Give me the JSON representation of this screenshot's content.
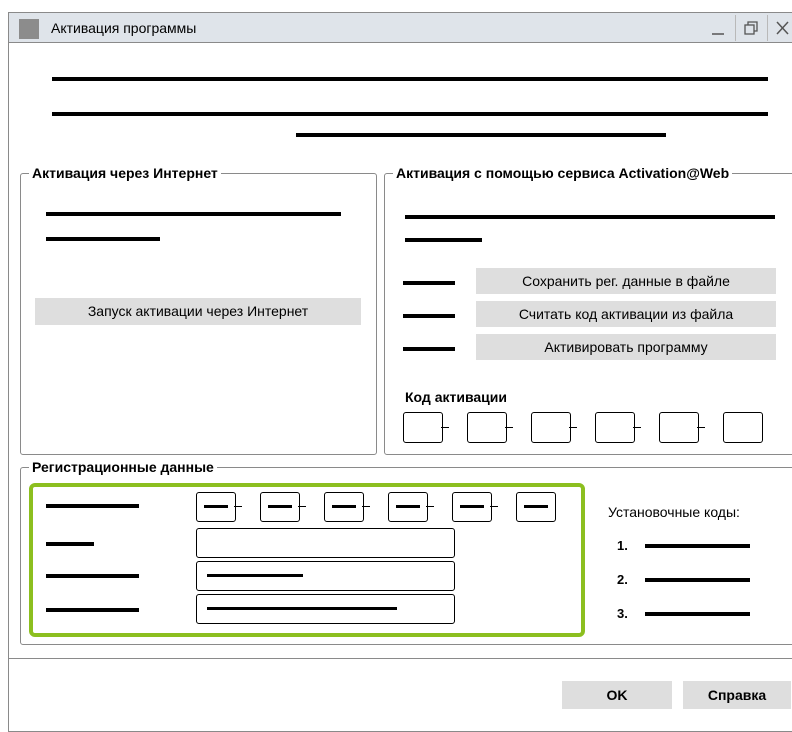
{
  "window": {
    "title": "Активация программы"
  },
  "internet": {
    "legend": "Активация через Интернет",
    "start_button": "Запуск активации через Интернет"
  },
  "web": {
    "legend": "Активация с помощью сервиса Activation@Web",
    "save_button": "Сохранить рег. данные в файле",
    "read_button": "Считать код активации из файла",
    "activate_button": "Активировать программу",
    "code_label": "Код активации"
  },
  "registration": {
    "legend": "Регистрационные данные",
    "install_codes_label": "Установочные коды:",
    "codes": [
      "1.",
      "2.",
      "3."
    ]
  },
  "footer": {
    "ok_button": "OK",
    "help_button": "Справка"
  },
  "colors": {
    "accent_green": "#8cbf1f",
    "button_gray": "#dedede",
    "titlebar": "#dfe4ea"
  },
  "icons": [
    "minimize-icon",
    "restore-icon",
    "close-icon",
    "app-icon"
  ]
}
